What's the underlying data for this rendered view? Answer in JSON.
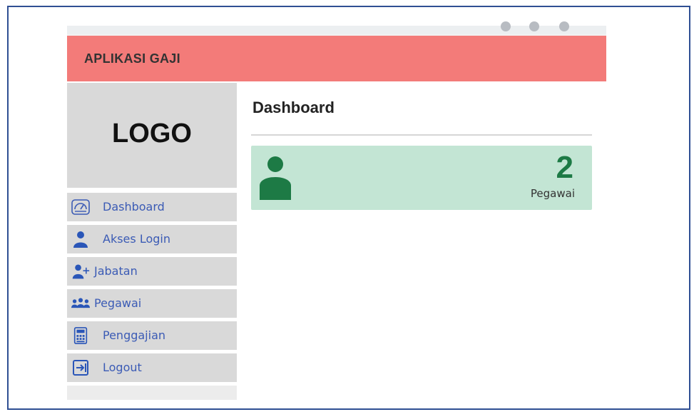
{
  "header": {
    "title": "APLIKASI GAJI",
    "color": "#f37b79"
  },
  "sidebar": {
    "logo": "LOGO",
    "items": [
      {
        "label": "Dashboard",
        "icon": "dashboard-gauge-icon"
      },
      {
        "label": "Akses Login",
        "icon": "user-icon"
      },
      {
        "label": "Jabatan",
        "icon": "user-add-icon"
      },
      {
        "label": "Pegawai",
        "icon": "users-group-icon"
      },
      {
        "label": "Penggajian",
        "icon": "calculator-icon"
      },
      {
        "label": "Logout",
        "icon": "logout-icon"
      }
    ]
  },
  "main": {
    "title": "Dashboard",
    "stat": {
      "count": "2",
      "label": "Pegawai",
      "color": "#1d7a45",
      "background": "#c3e5d4"
    }
  }
}
